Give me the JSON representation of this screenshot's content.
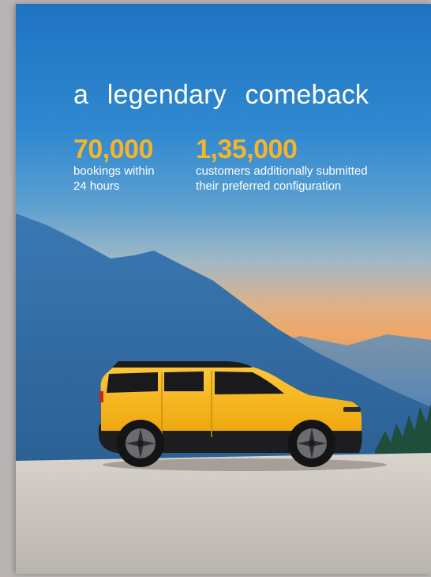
{
  "headline": "a legendary comeback",
  "stats": [
    {
      "value": "70,000",
      "label_line1": "bookings within",
      "label_line2": "24 hours"
    },
    {
      "value": "1,35,000",
      "label_line1": "customers additionally submitted",
      "label_line2": "their preferred configuration"
    }
  ],
  "colors": {
    "accent": "#f6b42c",
    "sky_top": "#1f73c2",
    "sunset": "#eea867",
    "car_body": "#f7b51d",
    "ground": "#c8c4bd"
  }
}
